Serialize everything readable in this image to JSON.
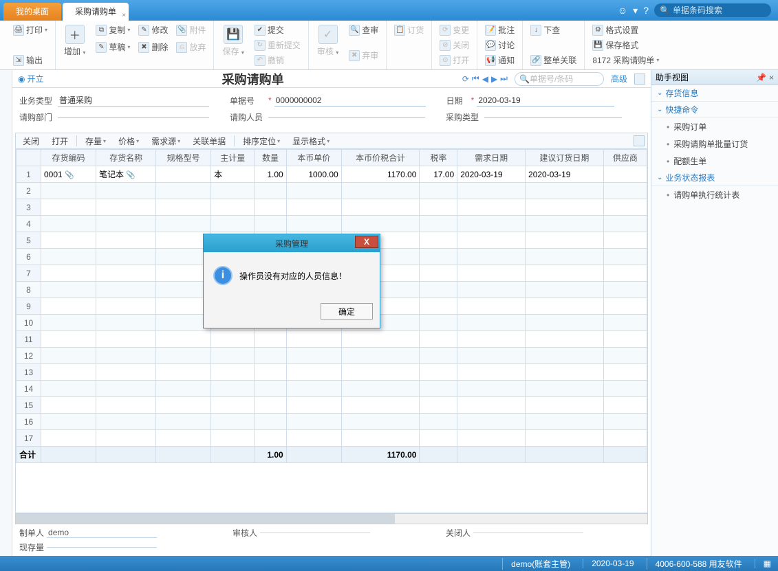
{
  "tabs": {
    "desktop": "我的桌面",
    "doc": "采购请购单"
  },
  "titlebar": {
    "searchPlaceholder": "单据条码搜索"
  },
  "ribbon": {
    "print": "打印",
    "export": "输出",
    "add": "增加",
    "copy": "复制",
    "modify": "修改",
    "attach": "附件",
    "draft": "草稿",
    "delete": "删除",
    "abandon": "放弃",
    "save": "保存",
    "submit": "提交",
    "resubmit": "重新提交",
    "undo": "撤销",
    "audit": "审核",
    "review": "查审",
    "disaudit": "弃审",
    "order": "订货",
    "change": "变更",
    "closeBtn": "关闭",
    "openBtn": "打开",
    "approve": "批注",
    "discuss": "讨论",
    "notify": "通知",
    "down": "下查",
    "linkAll": "整单关联",
    "fmt": "格式设置",
    "saveFmt": "保存格式",
    "tpl": "8172 采购请购单"
  },
  "docbar": {
    "open": "开立",
    "title": "采购请购单",
    "searchPlaceholder": "单据号/条码",
    "adv": "高级"
  },
  "form": {
    "bizTypeLbl": "业务类型",
    "bizType": "普通采购",
    "docNoLbl": "单据号",
    "docNo": "0000000002",
    "dateLbl": "日期",
    "date": "2020-03-19",
    "deptLbl": "请购部门",
    "dept": "",
    "personLbl": "请购人员",
    "person": "",
    "purTypeLbl": "采购类型",
    "purType": ""
  },
  "gridToolbar": {
    "close": "关闭",
    "open": "打开",
    "stock": "存量",
    "price": "价格",
    "src": "需求源",
    "rel": "关联单据",
    "sort": "排序定位",
    "disp": "显示格式"
  },
  "grid": {
    "headers": [
      "存货编码",
      "存货名称",
      "规格型号",
      "主计量",
      "数量",
      "本币单价",
      "本币价税合计",
      "税率",
      "需求日期",
      "建议订货日期",
      "供应商"
    ],
    "row": {
      "code": "0001",
      "name": "笔记本",
      "spec": "",
      "uom": "本",
      "qty": "1.00",
      "price": "1000.00",
      "total": "1170.00",
      "tax": "17.00",
      "reqDate": "2020-03-19",
      "sugDate": "2020-03-19",
      "vendor": ""
    },
    "sumLabel": "合计",
    "sumQty": "1.00",
    "sumTotal": "1170.00"
  },
  "footer": {
    "makerLbl": "制单人",
    "maker": "demo",
    "auditorLbl": "审核人",
    "closerLbl": "关闭人",
    "stockLbl": "现存量"
  },
  "rightPanel": {
    "title": "助手视图",
    "acc1": "存货信息",
    "acc2": "快捷命令",
    "items2": [
      "采购订单",
      "采购请购单批量订货",
      "配额生单"
    ],
    "acc3": "业务状态报表",
    "items3": [
      "请购单执行统计表"
    ]
  },
  "dialog": {
    "title": "采购管理",
    "msg": "操作员没有对应的人员信息！",
    "ok": "确定"
  },
  "status": {
    "user": "demo(账套主管)",
    "date": "2020-03-19",
    "tel": "4006-600-588 用友软件"
  }
}
